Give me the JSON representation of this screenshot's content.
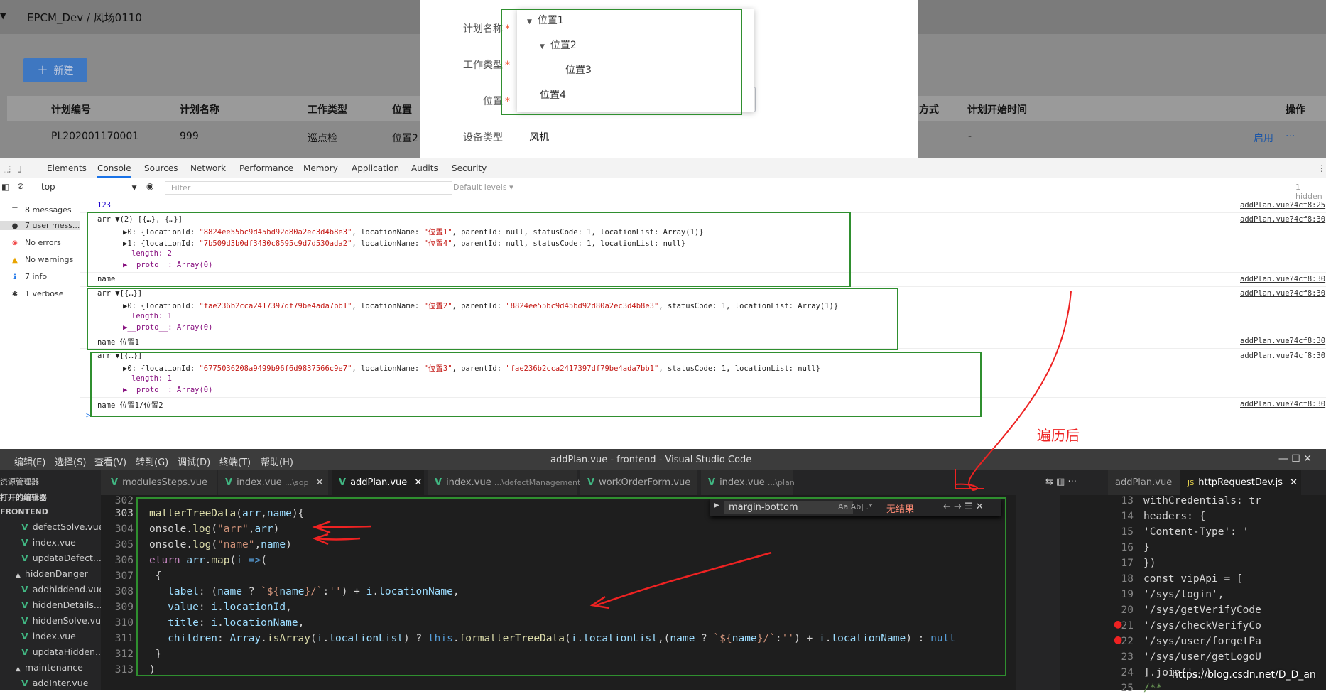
{
  "app": {
    "breadcrumb": "EPCM_Dev / 风场0110",
    "new_button": "新建",
    "table": {
      "headers": [
        "计划编号",
        "计划名称",
        "工作类型",
        "位置",
        "方式",
        "计划开始时间",
        "操作"
      ],
      "row": [
        "PL202001170001",
        "999",
        "巡点检",
        "位置2",
        "-"
      ],
      "actions": {
        "enable": "启用",
        "more": "···"
      }
    }
  },
  "modal": {
    "labels": {
      "plan_name": "计划名称",
      "work_type": "工作类型",
      "location": "位置",
      "device_type": "设备类型"
    },
    "required_mark": "*",
    "device_type_value": "风机",
    "tree": [
      {
        "label": "位置1",
        "level": 0,
        "expanded": true
      },
      {
        "label": "位置2",
        "level": 1,
        "expanded": true
      },
      {
        "label": "位置3",
        "level": 2
      },
      {
        "label": "位置4",
        "level": 0
      }
    ]
  },
  "devtools": {
    "tabs": [
      "Elements",
      "Console",
      "Sources",
      "Network",
      "Performance",
      "Memory",
      "Application",
      "Audits",
      "Security"
    ],
    "active_tab": "Console",
    "context": "top",
    "filter_placeholder": "Filter",
    "levels": "Default levels ▾",
    "hidden": "1 hidden",
    "sidebar": [
      {
        "icon": "list-icon",
        "label": "8 messages"
      },
      {
        "icon": "user-icon",
        "label": "7 user mess..."
      },
      {
        "icon": "error-icon",
        "label": "No errors"
      },
      {
        "icon": "warning-icon",
        "label": "No warnings"
      },
      {
        "icon": "info-icon",
        "label": "7 info"
      },
      {
        "icon": "verbose-icon",
        "label": "1 verbose"
      }
    ],
    "source": "addPlan.vue?4cf8:30",
    "source_first": "addPlan.vue?4cf8:25",
    "log": {
      "l0": "123",
      "l1_head": "arr ▼(2) [{…}, {…}]",
      "l1_a_pre": "▶0: {locationId: ",
      "l1_a_id": "\"8824ee55bc9d45bd92d80a2ec3d4b8e3\"",
      "l1_a_mid": ", locationName: ",
      "l1_a_name": "\"位置1\"",
      "l1_a_post": ", parentId: null, statusCode: 1, locationList: Array(1)}",
      "l1_b_pre": "▶1: {locationId: ",
      "l1_b_id": "\"7b509d3b0df3430c8595c9d7d530ada2\"",
      "l1_b_mid": ", locationName: ",
      "l1_b_name": "\"位置4\"",
      "l1_b_post": ", parentId: null, statusCode: 1, locationList: null}",
      "l1_len": "length: 2",
      "l1_proto": "▶__proto__: Array(0)",
      "l1_name": "name",
      "l2_head": "arr ▼[{…}]",
      "l2_a_pre": "▶0: {locationId: ",
      "l2_a_id": "\"fae236b2cca2417397df79be4ada7bb1\"",
      "l2_a_mid": ", locationName: ",
      "l2_a_name": "\"位置2\"",
      "l2_a_mid2": ", parentId: ",
      "l2_a_pid": "\"8824ee55bc9d45bd92d80a2ec3d4b8e3\"",
      "l2_a_post": ", statusCode: 1, locationList: Array(1)}",
      "l2_len": "length: 1",
      "l2_proto": "▶__proto__: Array(0)",
      "l2_name": "name 位置1",
      "l3_head": "arr ▼[{…}]",
      "l3_a_pre": "▶0: {locationId: ",
      "l3_a_id": "\"6775036208a9499b96f6d9837566c9e7\"",
      "l3_a_mid": ", locationName: ",
      "l3_a_name": "\"位置3\"",
      "l3_a_mid2": ", parentId: ",
      "l3_a_pid": "\"fae236b2cca2417397df79be4ada7bb1\"",
      "l3_a_post": ", statusCode: 1, locationList: null}",
      "l3_len": "length: 1",
      "l3_proto": "▶__proto__: Array(0)",
      "l3_name": "name 位置1/位置2",
      "prompt": ">"
    },
    "annotation": "遍历后"
  },
  "vscode": {
    "menu": [
      "编辑(E)",
      "选择(S)",
      "查看(V)",
      "转到(G)",
      "调试(D)",
      "终端(T)",
      "帮助(H)"
    ],
    "title": "addPlan.vue - frontend - Visual Studio Code",
    "window_controls": "—   ☐   ✕",
    "explorer": {
      "title": "资源管理器",
      "open_editors": "打开的编辑器",
      "root": "FRONTEND",
      "items": [
        "defectSolve.vue",
        "index.vue",
        "updataDefect....",
        "hiddenDanger",
        "addhiddend.vue",
        "hiddenDetails....",
        "hiddenSolve.vue",
        "index.vue",
        "updataHidden...",
        "maintenance",
        "addInter.vue"
      ]
    },
    "tabs": [
      {
        "label": "modulesSteps.vue",
        "hint": ""
      },
      {
        "label": "index.vue",
        "hint": "...\\sop"
      },
      {
        "label": "addPlan.vue",
        "hint": ""
      },
      {
        "label": "index.vue",
        "hint": "...\\defectManagement"
      },
      {
        "label": "workOrderForm.vue",
        "hint": ""
      },
      {
        "label": "index.vue",
        "hint": "...\\plan"
      }
    ],
    "tab_close": "✕",
    "right_tabs": [
      "addPlan.vue",
      "httpRequestDev.js"
    ],
    "find": {
      "value": "margin-bottom",
      "opts": "Aa  Ab|  .*",
      "result": "无结果",
      "nav": "←  →  ☰  ✕"
    },
    "line_numbers": [
      "302",
      "303",
      "304",
      "305",
      "306",
      "307",
      "308",
      "309",
      "310",
      "311",
      "312",
      "313"
    ],
    "right_line_numbers": [
      "13",
      "14",
      "15",
      "16",
      "17",
      "18",
      "19",
      "20",
      "21",
      "22",
      "23",
      "24",
      "25"
    ],
    "right_code": [
      "withCredentials: tr",
      "headers: {",
      "  'Content-Type': '",
      "}",
      "})",
      "const vipApi = [",
      "  '/sys/login',",
      "  '/sys/getVerifyCode",
      "  '/sys/checkVerifyCo",
      "  '/sys/user/forgetPa",
      "  '/sys/user/getLogoU",
      "].join(',')",
      "/**"
    ]
  },
  "watermark": "https://blog.csdn.net/D_D_an"
}
